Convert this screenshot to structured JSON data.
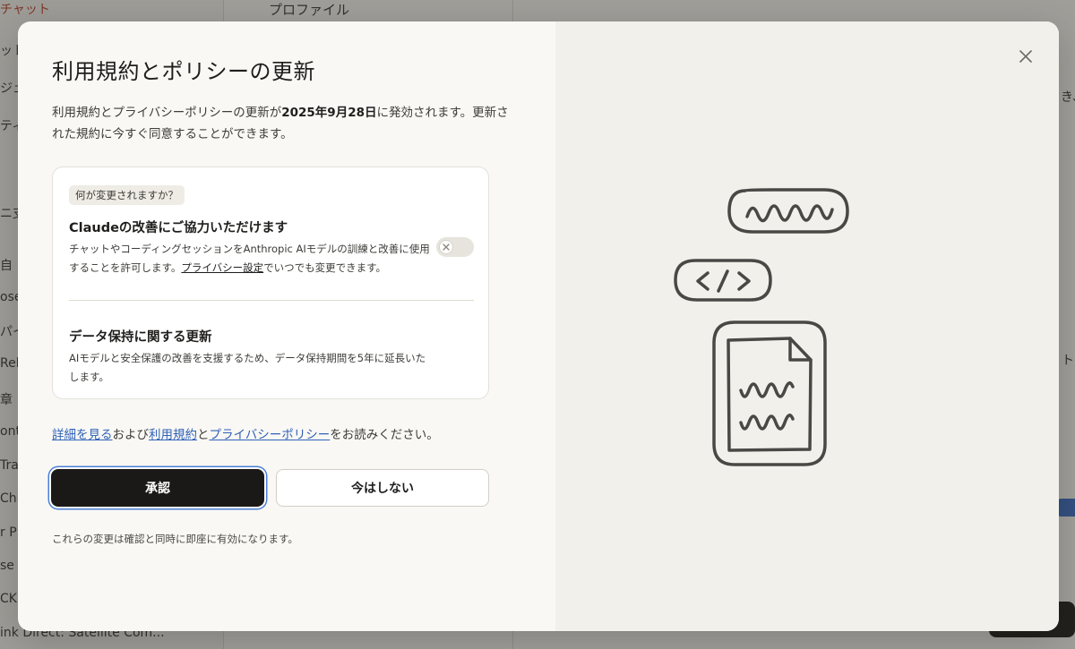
{
  "background": {
    "sidebar_items": [
      "チャット",
      "ット",
      "ジェ",
      "ティ",
      "ニ支",
      "自",
      "ose",
      "パイ",
      "Rel",
      "章",
      "ont",
      "Tra",
      "Chip",
      "r P",
      "se",
      "CK",
      "ink Direct: Satellite Com..."
    ],
    "header_tab": "プロファイル",
    "right_fragments": [
      "き、",
      "ト"
    ]
  },
  "modal": {
    "title": "利用規約とポリシーの更新",
    "intro_prefix": "利用規約とプライバシーポリシーの更新が",
    "intro_date": "2025年9月28日",
    "intro_suffix": "に発効されます。更新された規約に今すぐ同意することができます。",
    "card": {
      "badge": "何が変更されますか？",
      "section1": {
        "title": "Claudeの改善にご協力いただけます",
        "desc_prefix": "チャットやコーディングセッションをAnthropic AIモデルの訓練と改善に使用することを許可します。",
        "desc_link": "プライバシー設定",
        "desc_suffix": "でいつでも変更できます。",
        "toggle_state": "off"
      },
      "section2": {
        "title": "データ保持に関する更新",
        "desc": "AIモデルと安全保護の改善を支援するため、データ保持期間を5年に延長いたします。"
      }
    },
    "links": {
      "learn_more": "詳細を見る",
      "and1": "および",
      "terms": "利用規約",
      "and2": "と",
      "privacy": "プライバシーポリシー",
      "suffix": "をお読みください。"
    },
    "buttons": {
      "accept": "承認",
      "not_now": "今はしない"
    },
    "footnote": "これらの変更は確認と同時に即座に有効になります。"
  },
  "colors": {
    "primary_button": "#1a1918",
    "link": "#2f62b8",
    "modal_bg": "#faf8f5",
    "illustration_bg": "#f2f0eb",
    "overlay": "rgba(40,38,34,0.42)"
  },
  "icons": {
    "close": "close-icon",
    "toggle_knob": "x-icon",
    "illustration": [
      "chat-bubble-scribble-icon",
      "code-tag-icon",
      "document-icon"
    ]
  }
}
